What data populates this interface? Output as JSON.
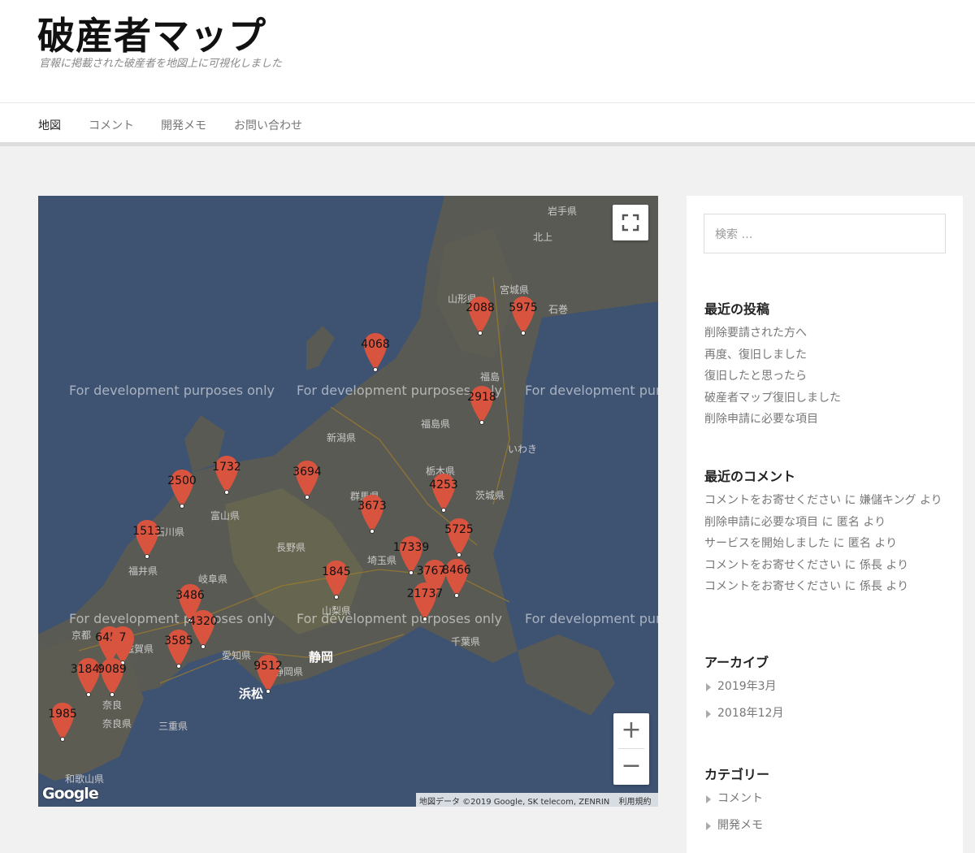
{
  "site": {
    "title": "破産者マップ",
    "description": "官報に掲載された破産者を地図上に可視化しました"
  },
  "nav": {
    "items": [
      {
        "label": "地図",
        "active": true
      },
      {
        "label": "コメント",
        "active": false
      },
      {
        "label": "開発メモ",
        "active": false
      },
      {
        "label": "お問い合わせ",
        "active": false
      }
    ]
  },
  "map": {
    "watermark": "For development purposes only",
    "place_labels": [
      "岩手県",
      "北上",
      "山形県",
      "宮城県",
      "石巻",
      "福島",
      "福島県",
      "新潟県",
      "いわき",
      "栃木県",
      "茨城県",
      "群馬県",
      "富山県",
      "石川県",
      "長野県",
      "埼玉県",
      "福井県",
      "岐阜県",
      "山梨県",
      "京都",
      "滋賀県",
      "愛知県",
      "静岡",
      "千葉県",
      "奈良",
      "奈良県",
      "三重県",
      "和歌山県",
      "浜松",
      "静岡県"
    ],
    "markers": [
      "2088",
      "5975",
      "4068",
      "2918",
      "1732",
      "2500",
      "3694",
      "4253",
      "3673",
      "1513",
      "5725",
      "17339",
      "1845",
      "37675",
      "8466",
      "21737",
      "3486",
      "4320",
      "3585",
      "6453",
      "7",
      "31848",
      "9089",
      "9512",
      "1985"
    ],
    "marker_color": "#d9543f",
    "attribution_data": "地図データ ©2019 Google, SK telecom, ZENRIN",
    "attribution_terms": "利用規約",
    "google_logo": "Google"
  },
  "sidebar": {
    "search_placeholder": "検索 …",
    "recent_posts_title": "最近の投稿",
    "recent_posts": [
      "削除要請された方へ",
      "再度、復旧しました",
      "復旧したと思ったら",
      "破産者マップ復旧しました",
      "削除申請に必要な項目"
    ],
    "recent_comments_title": "最近のコメント",
    "recent_comments": [
      {
        "post": "コメントをお寄せください",
        "connector": "に",
        "author": "嫌儲キング",
        "suffix": "より"
      },
      {
        "post": "削除申請に必要な項目",
        "connector": "に",
        "author": "匿名",
        "suffix": "より"
      },
      {
        "post": "サービスを開始しました",
        "connector": "に",
        "author": "匿名",
        "suffix": "より"
      },
      {
        "post": "コメントをお寄せください",
        "connector": "に",
        "author": "係長",
        "suffix": "より"
      },
      {
        "post": "コメントをお寄せください",
        "connector": "に",
        "author": "係長",
        "suffix": "より"
      }
    ],
    "archives_title": "アーカイブ",
    "archives": [
      "2019年3月",
      "2018年12月"
    ],
    "categories_title": "カテゴリー",
    "categories": [
      "コメント",
      "開発メモ"
    ]
  }
}
